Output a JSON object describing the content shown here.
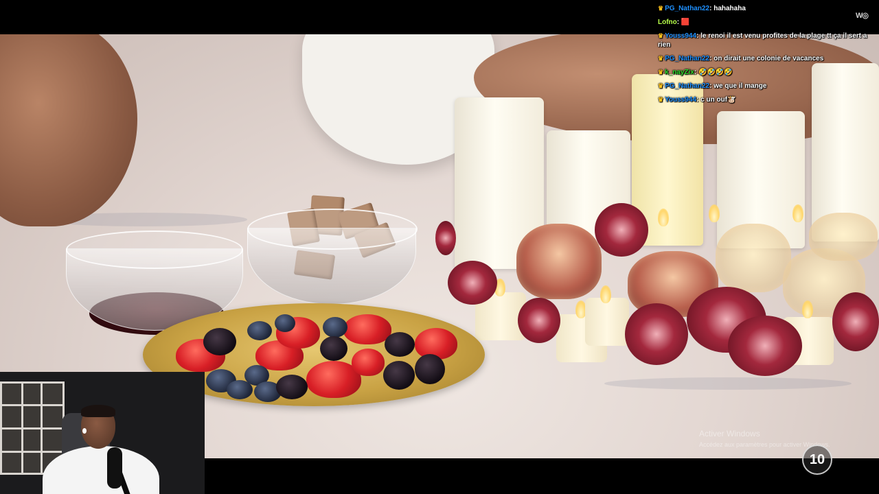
{
  "chat": {
    "messages": [
      {
        "user": "PG_Nathan22",
        "user_color": "#1e90ff",
        "text": "hahahaha",
        "badge": "crown"
      },
      {
        "user": "Lofno",
        "user_color": "#b8ff4a",
        "text": "",
        "emote": "🟥",
        "badge": ""
      },
      {
        "user": "Youss944",
        "user_color": "#1e90ff",
        "text": "le renoi il est venu profites de la plage tt ça il sert a rien",
        "badge": "crown"
      },
      {
        "user": "PG_Nathan22",
        "user_color": "#1e90ff",
        "text": "on dirait une colonie de vacances",
        "badge": "crown"
      },
      {
        "user": "k_nayZix",
        "user_color": "#2bd92b",
        "text": "",
        "emote": "🤣🤣🤣🤣",
        "badge": "crown"
      },
      {
        "user": "PG_Nathan22",
        "user_color": "#1e90ff",
        "text": "we que il mange",
        "badge": "crown"
      },
      {
        "user": "Youss944",
        "user_color": "#1e90ff",
        "text": "c un ouf",
        "emote": "🐮",
        "badge": "crown"
      }
    ]
  },
  "windows_watermark": {
    "line1": "Activer Windows",
    "line2": "Accédez aux paramètres pour activer Windows."
  },
  "channel_logo": "10",
  "corner_logo": "W◎",
  "colors": {
    "crown": "#ffc21a",
    "background": "#000000"
  }
}
